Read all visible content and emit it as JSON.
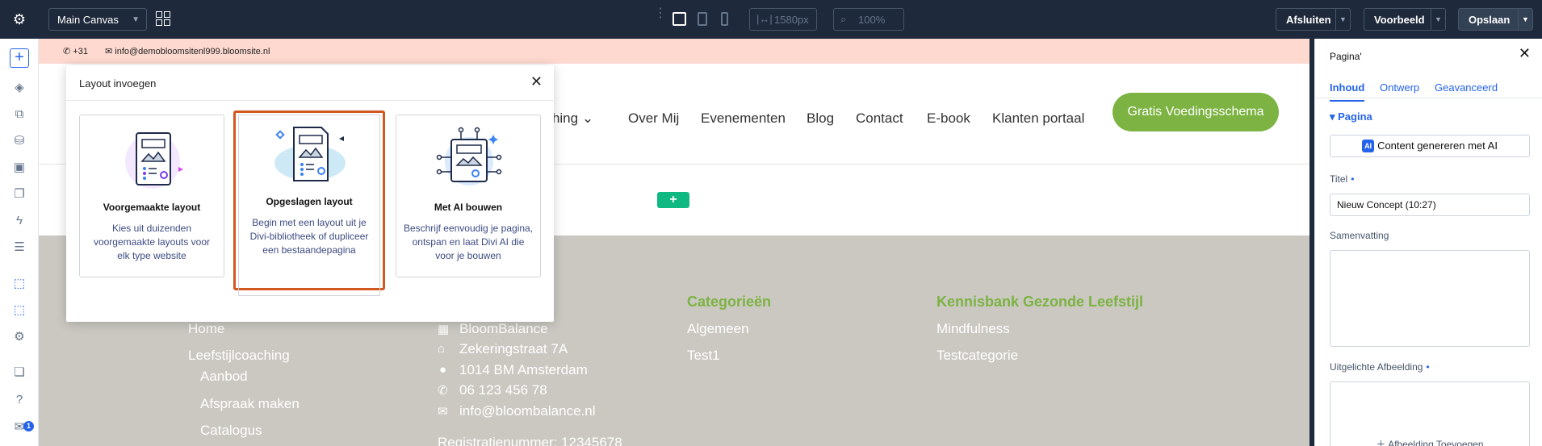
{
  "topbar": {
    "canvas_select": "Main Canvas",
    "width_value": "1580px",
    "zoom_value": "100%",
    "afsluiten": "Afsluiten",
    "voorbeeld": "Voorbeeld",
    "opslaan": "Opslaan"
  },
  "site": {
    "phone": "+31",
    "email": "info@demobloomsitenl999.bloomsite.nl",
    "nav": [
      "Leefstijlcoaching",
      "Over Mij",
      "Evenementen",
      "Blog",
      "Contact",
      "E-book",
      "Klanten portaal"
    ],
    "nav_partial": "aching",
    "cta": "Gratis Voedingsschema"
  },
  "footer": {
    "col1": [
      "Home",
      "Leefstijlcoaching",
      "Aanbod",
      "Afspraak maken",
      "Catalogus"
    ],
    "col2": [
      "BloomBalance",
      "Zekeringstraat 7A",
      "1014 BM Amsterdam",
      "06 123 456 78",
      "info@bloombalance.nl",
      "Registratienummer: 12345678"
    ],
    "col3_title": "Categorieën",
    "col3": [
      "Algemeen",
      "Test1"
    ],
    "col4_title": "Kennisbank Gezonde Leefstijl",
    "col4": [
      "Mindfulness",
      "Testcategorie"
    ]
  },
  "modal": {
    "title": "Layout invoegen",
    "cards": [
      {
        "title": "Voorgemaakte layout",
        "desc": "Kies uit duizenden voorgemaakte layouts voor elk type website"
      },
      {
        "title": "Opgeslagen layout",
        "desc": "Begin met een layout uit je Divi-bibliotheek of dupliceer een bestaandepagina"
      },
      {
        "title": "Met AI bouwen",
        "desc": "Beschrijf eenvoudig je pagina, ontspan en laat Divi AI die voor je bouwen"
      }
    ]
  },
  "panel": {
    "title": "Pagina'",
    "tabs": [
      "Inhoud",
      "Ontwerp",
      "Geavanceerd"
    ],
    "section": "Pagina",
    "ai_badge": "AI",
    "ai_button": "Content genereren met AI",
    "titel_label": "Titel",
    "titel_value": "Nieuw Concept (10:27)",
    "samenvatting_label": "Samenvatting",
    "afbeelding_label": "Uitgelichte Afbeelding",
    "afbeelding_button": "Afbeelding Toevoegen"
  },
  "sidebar": {
    "badge": "1"
  },
  "colors": {
    "brand_green": "#7cb342",
    "accent_blue": "#2563eb",
    "highlight": "#d2581f"
  }
}
